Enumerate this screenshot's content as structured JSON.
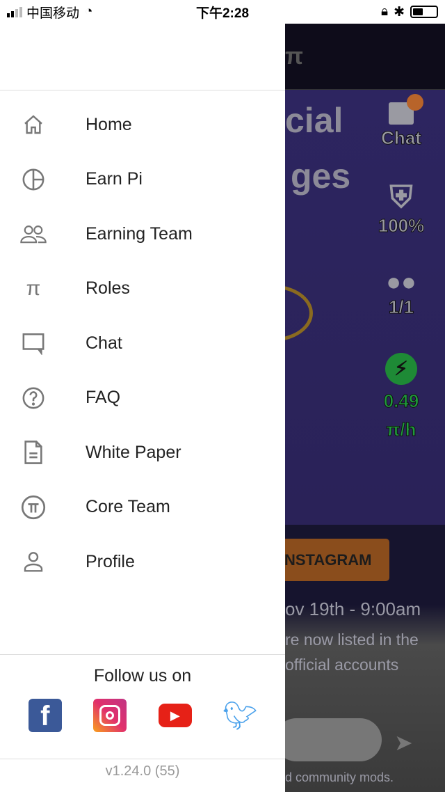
{
  "status_bar": {
    "carrier": "中国移动",
    "time": "下午2:28"
  },
  "background": {
    "header_fragment": "π",
    "hero_line1": "cial",
    "hero_line2": "ges",
    "side_stats": [
      {
        "icon": "chat-icon",
        "label": "Chat"
      },
      {
        "icon": "shield-icon",
        "label": "100%"
      },
      {
        "icon": "team-icon",
        "label": "1/1"
      },
      {
        "icon": "lightning-icon",
        "label": "0.49",
        "unit": "π/h"
      }
    ],
    "instagram_button": "NSTAGRAM",
    "date_text": "ov 19th - 9:00am",
    "body_line1": "re now listed in the",
    "body_line2": "official accounts",
    "footer_text": "d community mods.",
    "accent": "#8a4d1c",
    "rate_color": "#1e9a3a"
  },
  "drawer": {
    "items": [
      {
        "label": "Home",
        "icon": "home-icon"
      },
      {
        "label": "Earn Pi",
        "icon": "pie-chart-icon"
      },
      {
        "label": "Earning Team",
        "icon": "team-icon"
      },
      {
        "label": "Roles",
        "icon": "pi-icon"
      },
      {
        "label": "Chat",
        "icon": "chat-icon"
      },
      {
        "label": "FAQ",
        "icon": "question-icon"
      },
      {
        "label": "White Paper",
        "icon": "document-icon"
      },
      {
        "label": "Core Team",
        "icon": "pi-circle-icon"
      },
      {
        "label": "Profile",
        "icon": "person-icon"
      }
    ],
    "follow_label": "Follow us on",
    "socials": [
      "facebook",
      "instagram",
      "youtube",
      "twitter"
    ],
    "version": "v1.24.0 (55)"
  }
}
